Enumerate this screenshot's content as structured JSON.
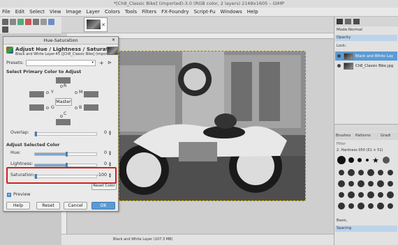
{
  "window": {
    "title": "*[Ch8_Classic Bike] (imported)-3.0 (RGB color, 2 layers) 2168x1605 – GIMP"
  },
  "menu": [
    "File",
    "Edit",
    "Select",
    "View",
    "Image",
    "Layer",
    "Colors",
    "Tools",
    "Filters",
    "FX-Foundry",
    "Script-Fu",
    "Windows",
    "Help"
  ],
  "status": {
    "text": "Black and White Layer (107.3 MB)"
  },
  "dock": {
    "mode_label": "Mode:",
    "mode_value": "Normal",
    "opacity_label": "Opacity",
    "lock_label": "Lock:",
    "layers": [
      "Black and White Lay",
      "Ch8_Classic Bike.jpg"
    ],
    "brush_tabs": [
      "Brushes",
      "Patterns",
      "Gradi"
    ],
    "brush_filter": "Filter",
    "brush_name": "2. Hardness 050 (51 × 51)",
    "brush_category": "Basic,",
    "spacing_label": "Spacing"
  },
  "dialog": {
    "title": "Hue-Saturation",
    "heading": "Adjust Hue / Lightness / Saturation",
    "subtitle": "Black and White Layer-45 ([Ch8_Classic Bike] (impor...",
    "presets_label": "Presets:",
    "primary_label": "Select Primary Color to Adjust",
    "colors": {
      "R": "R",
      "Y": "Y",
      "M": "M",
      "G": "G",
      "B": "B",
      "C": "C",
      "master": "Master"
    },
    "overlap_label": "Overlap:",
    "overlap_value": "0",
    "adjust_label": "Adjust Selected Color",
    "hue_label": "Hue:",
    "hue_value": "0",
    "lightness_label": "Lightness:",
    "lightness_value": "0",
    "saturation_label": "Saturation:",
    "saturation_value": "-100",
    "reset_color": "Reset Color",
    "preview_label": "Preview",
    "buttons": {
      "help": "Help",
      "reset": "Reset",
      "cancel": "Cancel",
      "ok": "OK"
    }
  }
}
